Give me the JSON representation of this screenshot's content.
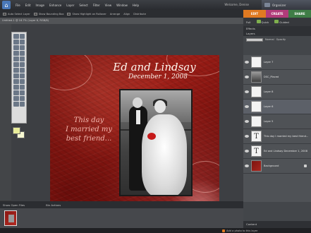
{
  "menubar": {
    "items": [
      "File",
      "Edit",
      "Image",
      "Enhance",
      "Layer",
      "Select",
      "Filter",
      "View",
      "Window",
      "Help"
    ],
    "welcome": "Welcome, Denise",
    "organizer": "Organizer"
  },
  "options": [
    "Auto Select Layer",
    "Show Bounding Box",
    "Show Highlight on Rollover",
    "Arrange",
    "Align",
    "Distribute"
  ],
  "mode_tabs": [
    "EDIT",
    "CREATE",
    "SHARE"
  ],
  "document": {
    "title": "Untitled-1 @ 16.7% (Layer 6, RGB/8)"
  },
  "canvas": {
    "title": "Ed and Lindsay",
    "date": "December 1, 2008",
    "quote_lines": [
      "This day",
      "I married my",
      "best friend..."
    ]
  },
  "right_panel": {
    "tabs": [
      "Effects",
      "Layers"
    ],
    "quick": "Quick",
    "guided": "Guided",
    "full": "Full",
    "blend_mode": "Normal",
    "opacity_label": "Opacity",
    "layers": [
      {
        "name": "Layer 7",
        "type": "blank"
      },
      {
        "name": "DSC_Placed",
        "type": "photo"
      },
      {
        "name": "Layer 8",
        "type": "blank"
      },
      {
        "name": "Layer 6",
        "type": "blank"
      },
      {
        "name": "Layer 5",
        "type": "blank"
      },
      {
        "name": "This day I married my best friend...",
        "type": "text"
      },
      {
        "name": "Ed and Lindsay December 1, 2008",
        "type": "text"
      },
      {
        "name": "Background",
        "type": "background"
      }
    ],
    "content_header": "Content"
  },
  "bin": {
    "label": "Show Open Files",
    "actions": "Bin Actions"
  },
  "status": {
    "add_photo": "Add a photo to this layer"
  },
  "colors": {
    "edit_tab": "#e07a22",
    "create_tab": "#b23b7a",
    "share_tab": "#3f7d46",
    "canvas_red": "#9e1e17"
  }
}
